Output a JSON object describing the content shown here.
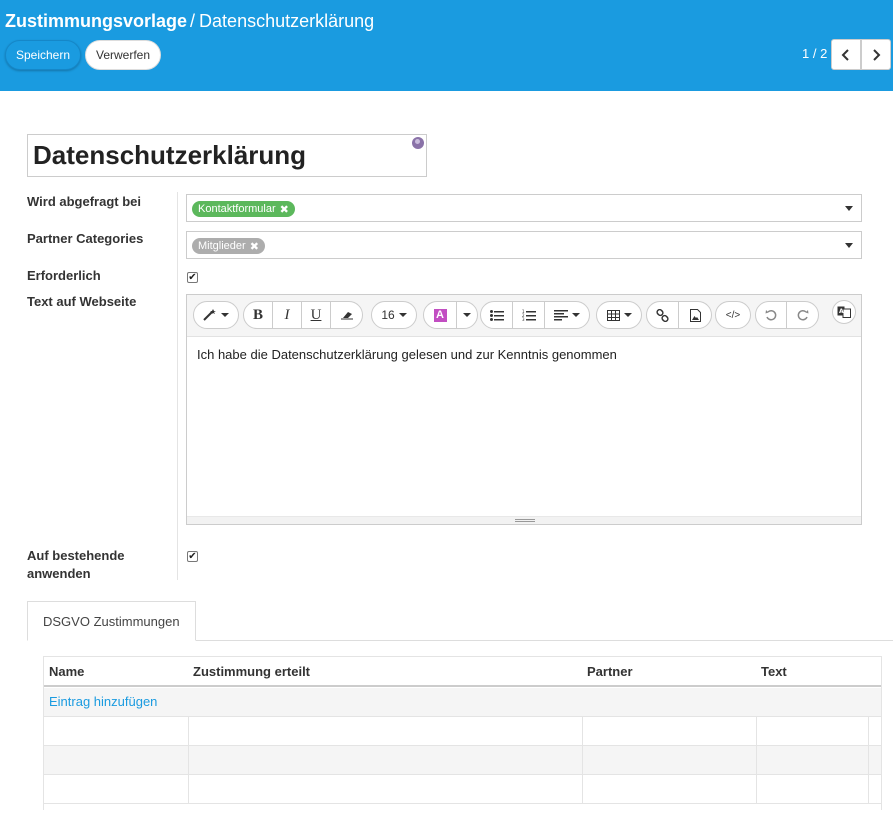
{
  "breadcrumb": {
    "root": "Zustimmungsvorlage",
    "separator": "/",
    "current": "Datenschutzerklärung"
  },
  "buttons": {
    "save": "Speichern",
    "discard": "Verwerfen"
  },
  "pager": {
    "value": "1 / 2"
  },
  "record": {
    "title": "Datenschutzerklärung"
  },
  "fields": {
    "asked_at": {
      "label": "Wird abgefragt bei",
      "tags": [
        "Kontaktformular"
      ]
    },
    "partner_categories": {
      "label": "Partner Categories",
      "tags": [
        "Mitglieder"
      ]
    },
    "required": {
      "label": "Erforderlich",
      "checked": true
    },
    "website_text": {
      "label": "Text auf Webseite",
      "content": "Ich habe die Datenschutzerklärung gelesen und zur Kenntnis genommen"
    },
    "apply_existing": {
      "label_line1": "Auf bestehende",
      "label_line2": "anwenden",
      "checked": true
    }
  },
  "toolbar": {
    "font_size": "16",
    "bold": "B",
    "italic": "I",
    "underline": "U",
    "code": "</>"
  },
  "notebook": {
    "tabs": [
      "DSGVO Zustimmungen"
    ]
  },
  "consents_table": {
    "columns": [
      "Name",
      "Zustimmung erteilt",
      "Partner",
      "Text"
    ],
    "add_link": "Eintrag hinzufügen"
  },
  "colors": {
    "primary": "#1a9be0",
    "tag_green": "#5cb85c",
    "tag_grey": "#adadad"
  }
}
